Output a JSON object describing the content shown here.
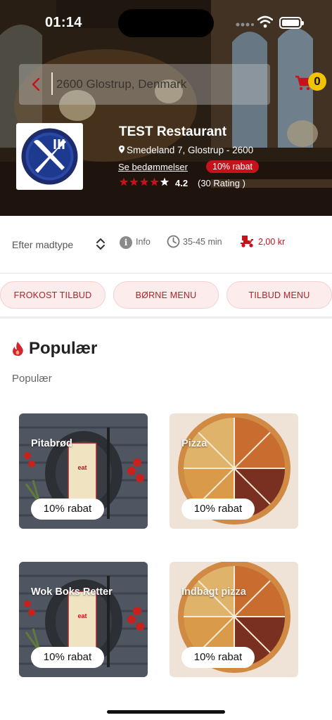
{
  "status": {
    "time": "01:14"
  },
  "search": {
    "value": "2600 Glostrup, Denmark"
  },
  "cart": {
    "count": "0"
  },
  "restaurant": {
    "name": "TEST Restaurant",
    "address": "Smedeland 7, Glostrup - 2600",
    "reviews_link": "Se bedømmelser",
    "discount": "10% rabat",
    "rating": "4.2",
    "rating_count": "(30 Rating )",
    "stars": 4
  },
  "info_row": {
    "filter_label": "Efter madtype",
    "info_label": "Info",
    "delivery_time": "35-45 min",
    "delivery_fee": "2,00 kr"
  },
  "categories": [
    "FROKOST TILBUD",
    "BØRNE MENU",
    "TILBUD MENU"
  ],
  "section": {
    "title": "Populær",
    "subtitle": "Populær"
  },
  "items": [
    {
      "name": "Pitabrød",
      "tag": "10% rabat"
    },
    {
      "name": "Pizza",
      "tag": "10% rabat"
    },
    {
      "name": "Wok Boks Retter",
      "tag": "10% rabat"
    },
    {
      "name": "Indbagt pizza",
      "tag": "10% rabat"
    }
  ],
  "colors": {
    "accent": "#c7121b",
    "pill_bg": "#fdecec",
    "badge": "#f2c300"
  }
}
